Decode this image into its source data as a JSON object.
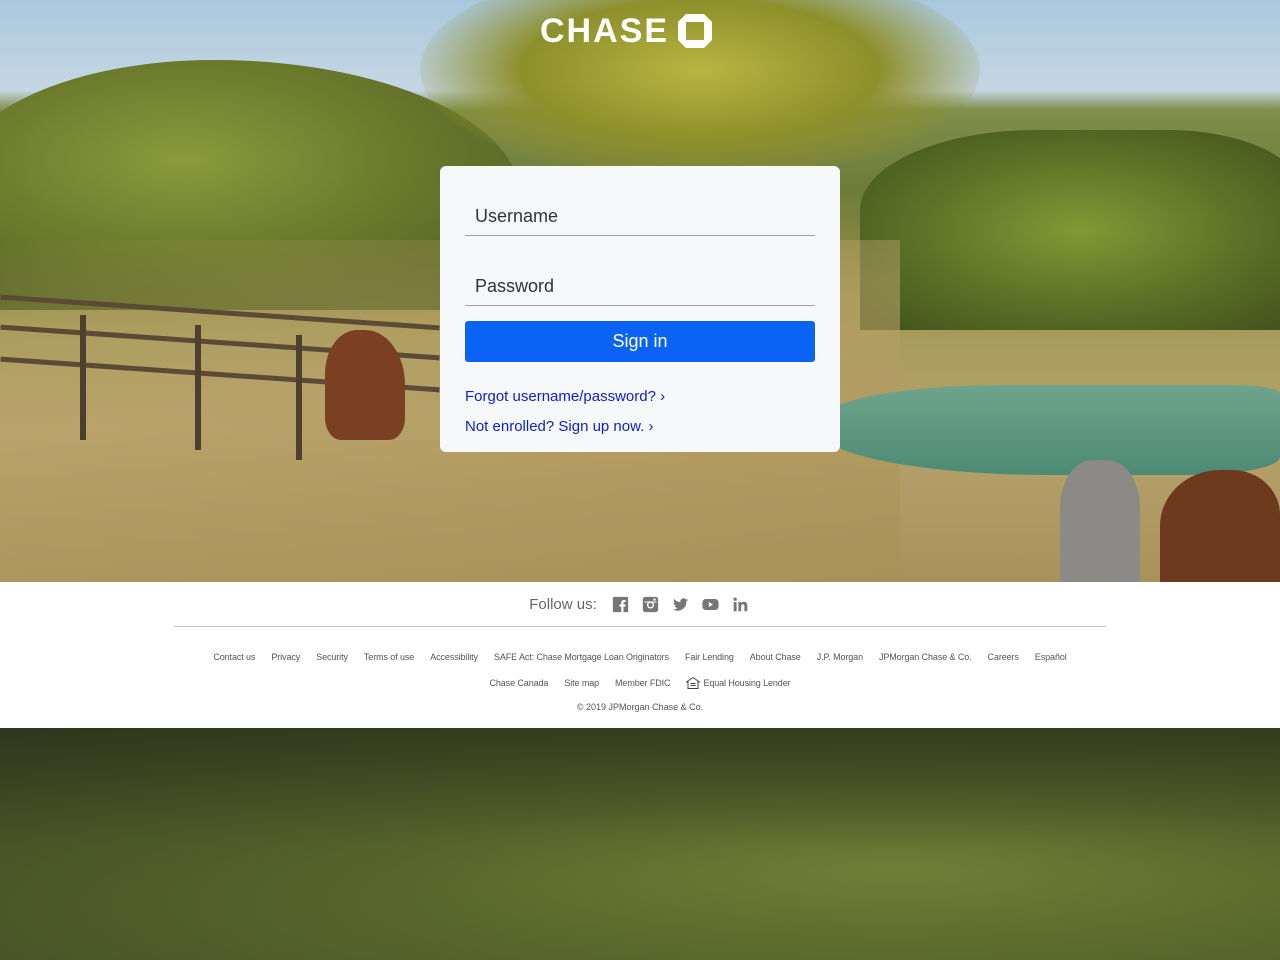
{
  "brand": {
    "logo_text": "CHASE",
    "logo_mark_color": "#ffffff"
  },
  "login": {
    "username_placeholder": "Username",
    "password_placeholder": "Password",
    "signin_label": "Sign in",
    "forgot_link": "Forgot username/password? ›",
    "enroll_link": "Not enrolled? Sign up now. ›",
    "signin_color": "#0b63f6",
    "link_color": "#0b1fcc"
  },
  "footer": {
    "follow_label": "Follow us:",
    "social_icons": [
      "facebook-icon",
      "instagram-icon",
      "twitter-icon",
      "youtube-icon",
      "linkedin-icon"
    ],
    "links_row1": [
      "Contact us",
      "Privacy",
      "Security",
      "Terms of use",
      "Accessibility",
      "SAFE Act: Chase Mortgage Loan Originators",
      "Fair Lending",
      "About Chase",
      "J.P. Morgan",
      "JPMorgan Chase & Co.",
      "Careers",
      "Español"
    ],
    "links_row2": [
      "Chase Canada",
      "Site map",
      "Member FDIC",
      "Equal Housing Lender"
    ],
    "copyright": "© 2019 JPMorgan Chase & Co."
  }
}
